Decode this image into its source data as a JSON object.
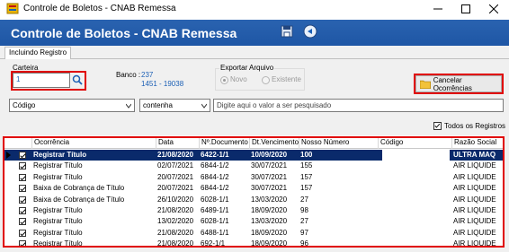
{
  "window": {
    "title": "Controle de Boletos - CNAB Remessa"
  },
  "header": {
    "title": "Controle de Boletos - CNAB Remessa"
  },
  "tabs": [
    {
      "label": "Incluindo Registro"
    }
  ],
  "filters": {
    "carteira_label": "Carteira",
    "carteira_value": "1",
    "banco_label": "Banco :",
    "banco_code": "237",
    "banco_agency": "1451 - 19038",
    "export_label": "Exportar Arquivo",
    "export_options": [
      "Novo",
      "Existente"
    ],
    "cancel_label": "Cancelar Ocorrências",
    "field_select": "Código",
    "operator_select": "contenha",
    "search_placeholder": "Digite aqui o valor a ser pesquisado",
    "all_records_label": "Todos os Registros"
  },
  "grid": {
    "columns": [
      "Ocorrência",
      "Data",
      "Nº.Documento",
      "Dt.Vencimento",
      "Nosso Número",
      "Código",
      "Razão Social"
    ],
    "rows": [
      {
        "ocorrencia": "Registrar Título",
        "data": "21/08/2020",
        "documento": "6422-1/1",
        "vencimento": "10/09/2020",
        "nosso_numero": "100",
        "codigo": "",
        "razao": "ULTRA MAQ"
      },
      {
        "ocorrencia": "Registrar Título",
        "data": "02/07/2021",
        "documento": "6844-1/2",
        "vencimento": "30/07/2021",
        "nosso_numero": "155",
        "codigo": "",
        "razao": "AIR LIQUIDE"
      },
      {
        "ocorrencia": "Registrar Título",
        "data": "20/07/2021",
        "documento": "6844-1/2",
        "vencimento": "30/07/2021",
        "nosso_numero": "157",
        "codigo": "",
        "razao": "AIR LIQUIDE"
      },
      {
        "ocorrencia": "Baixa de Cobrança de Título",
        "data": "20/07/2021",
        "documento": "6844-1/2",
        "vencimento": "30/07/2021",
        "nosso_numero": "157",
        "codigo": "",
        "razao": "AIR LIQUIDE"
      },
      {
        "ocorrencia": "Baixa de Cobrança de Título",
        "data": "26/10/2020",
        "documento": "6028-1/1",
        "vencimento": "13/03/2020",
        "nosso_numero": "27",
        "codigo": "",
        "razao": "AIR LIQUIDE"
      },
      {
        "ocorrencia": "Registrar Título",
        "data": "21/08/2020",
        "documento": "6489-1/1",
        "vencimento": "18/09/2020",
        "nosso_numero": "98",
        "codigo": "",
        "razao": "AIR LIQUIDE"
      },
      {
        "ocorrencia": "Registrar Título",
        "data": "13/02/2020",
        "documento": "6028-1/1",
        "vencimento": "13/03/2020",
        "nosso_numero": "27",
        "codigo": "",
        "razao": "AIR LIQUIDE"
      },
      {
        "ocorrencia": "Registrar Título",
        "data": "21/08/2020",
        "documento": "6488-1/1",
        "vencimento": "18/09/2020",
        "nosso_numero": "97",
        "codigo": "",
        "razao": "AIR LIQUIDE"
      },
      {
        "ocorrencia": "Registrar Título",
        "data": "21/08/2020",
        "documento": "692-1/1",
        "vencimento": "18/09/2020",
        "nosso_numero": "96",
        "codigo": "",
        "razao": "AIR LIQUIDE"
      }
    ]
  },
  "colors": {
    "header_blue": "#1e56a5",
    "selected_row": "#0a2a6b",
    "highlight_red": "#e00000",
    "link_blue": "#1b5fb5"
  }
}
